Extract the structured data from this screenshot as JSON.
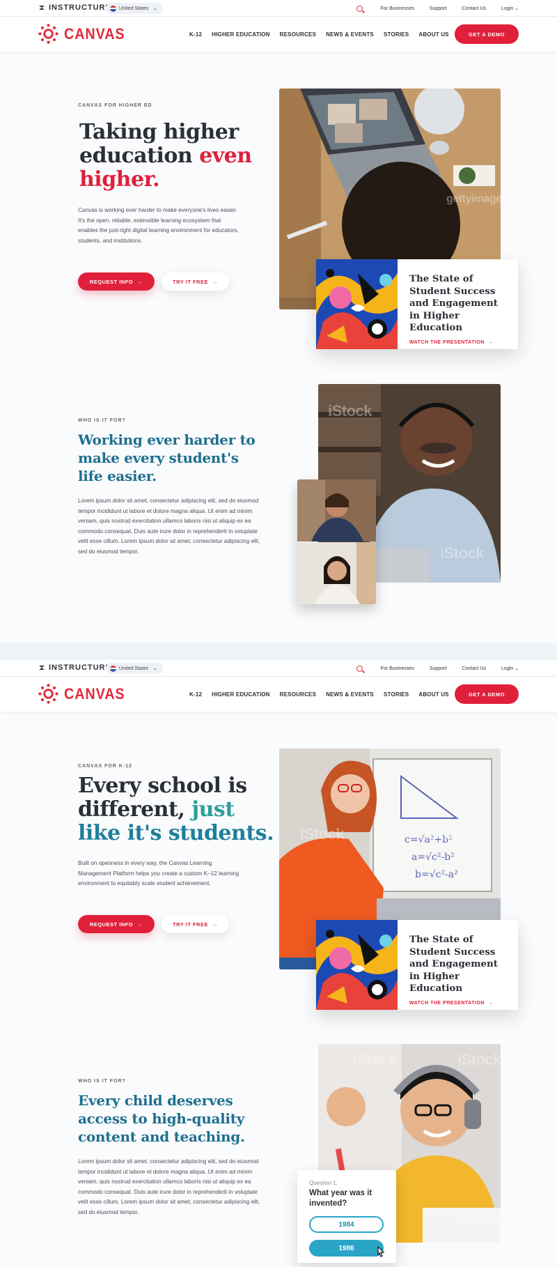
{
  "utility_bar": {
    "brand": "INSTRUCTURE",
    "region": "United States",
    "links": [
      "For Businesses",
      "Support",
      "Contact Us",
      "Login"
    ]
  },
  "nav": {
    "logo": "CANVAS",
    "items": [
      "K-12",
      "HIGHER EDUCATION",
      "RESOURCES",
      "NEWS & EVENTS",
      "STORIES",
      "ABOUT US"
    ],
    "cta": "GET A DEMO"
  },
  "higher_ed": {
    "eyebrow": "CANVAS FOR HIGHER ED",
    "title_line1": "Taking higher",
    "title_line2a": "education ",
    "title_line2b": "even",
    "title_line3": "higher.",
    "body": "Canvas is working ever harder to make everyone's lives easier. It's the open, reliable, extensible learning ecosystem that enables the just-right digital learning environment for educators, students, and institutions.",
    "btn_primary": "REQUEST INFO",
    "btn_secondary": "TRY IT FREE",
    "watermark": "gettyimages",
    "promo_title": "The State of Student Success and Engagement in Higher Education",
    "promo_link": "WATCH THE PRESENTATION"
  },
  "higher_who": {
    "eyebrow": "WHO IS IT FOR?",
    "title": "Working ever harder to make every student's life easier.",
    "body": "Lorem ipsum dolor sit amet, consectetur adipiscing elit, sed do eiusmod tempor incididunt ut labore et dolore magna aliqua. Ut enim ad minim veniam, quis nostrud exercitation ullamco laboris nisi ut aliquip ex ea commodo consequat. Duis aute irure dolor in reprehenderit in voluptate velit esse cillum.  Lorem ipsum dolor sit amet, consectetur adipiscing elit, sed do eiusmod tempor.",
    "watermark": "iStock"
  },
  "k12": {
    "eyebrow": "CANVAS FOR K-12",
    "title_line1": "Every school is",
    "title_line2a": "different, ",
    "title_line2b": "just",
    "title_line3": "like it's students.",
    "body": "Built on openness in every way, the Canvas Learning Management Platform helps you create a custom K–12 learning environment to equitably scale student achievement.",
    "btn_primary": "REQUEST INFO",
    "btn_secondary": "TRY IT FREE",
    "watermark": "iStock",
    "promo_title": "The State of Student Success and Engagement in Higher Education",
    "promo_link": "WATCH THE PRESENTATION"
  },
  "k12_who": {
    "eyebrow": "WHO IS IT FOR?",
    "title": "Every child deserves access to high-quality content and teaching.",
    "body": "Lorem ipsum dolor sit amet, consectetur adipiscing elit, sed do eiusmod tempor incididunt ut labore et dolore magna aliqua. Ut enim ad minim veniam, quis nostrud exercitation ullamco laboris nisi ut aliquip ex ea commodo consequat. Duis aute irure dolor in reprehenderit in voluptate velit esse cillum.  Lorem ipsum dolor sit amet, consectetur adipiscing elit, sed do eiusmod tempor.",
    "watermark": "iStock",
    "quiz": {
      "label": "Question 1:",
      "question": "What year was it invented?",
      "options": [
        "1984",
        "1986"
      ],
      "selected": "1986"
    }
  },
  "colors": {
    "brand_red": "#e0203a",
    "heading_teal": "#1f6f8f",
    "accent_teal": "#2c9f9c"
  },
  "icons": [
    "instructure-logo-icon",
    "flag-us-icon",
    "search-icon",
    "chevron-down-icon",
    "canvas-logo-icon",
    "arrow-right-icon",
    "cursor-icon"
  ]
}
